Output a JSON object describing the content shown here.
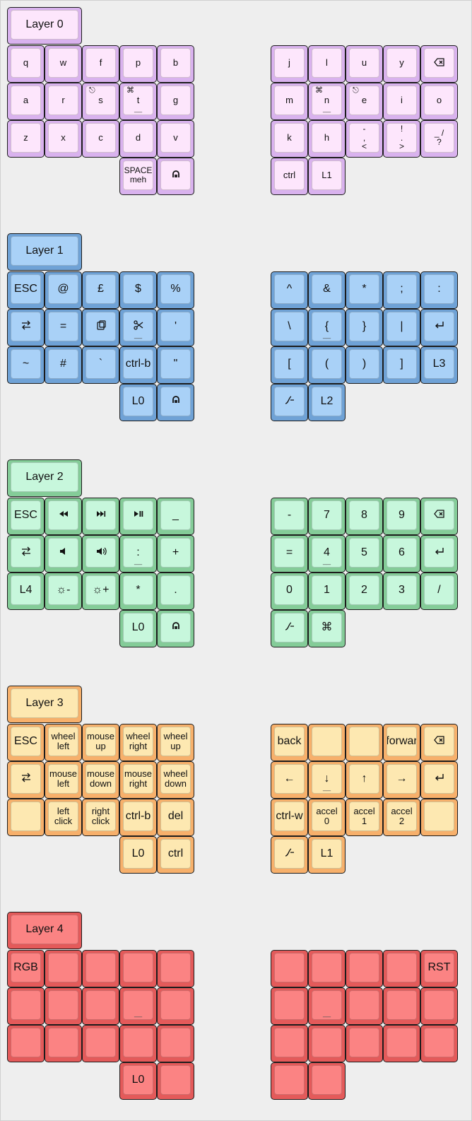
{
  "layers": [
    {
      "title": "Layer 0",
      "colors": {
        "outer": "#d9b2ee",
        "inner": "#fde6fc"
      },
      "size": "small",
      "left": [
        [
          "q",
          "w",
          "f",
          "p",
          "b"
        ],
        [
          "a",
          "r",
          {
            "label": "s",
            "hold": "⎋"
          },
          {
            "label": "t",
            "hold": "⌘",
            "mark": "__"
          },
          "g"
        ],
        [
          "z",
          "x",
          "c",
          "d",
          "v"
        ],
        [
          null,
          null,
          null,
          {
            "label": "SPACE\nmeh",
            "size": "tiny"
          },
          {
            "icon": "sym-icon"
          }
        ]
      ],
      "right": [
        [
          "j",
          "l",
          "u",
          "y",
          {
            "icon": "backspace-icon"
          }
        ],
        [
          "m",
          {
            "label": "n",
            "hold": "⌘",
            "mark": "__"
          },
          {
            "label": "e",
            "hold": "⎋"
          },
          "i",
          "o"
        ],
        [
          "k",
          "h",
          {
            "label": "-\n,\n<",
            "size": "tiny"
          },
          {
            "label": "!\n.\n>",
            "size": "tiny"
          },
          {
            "label": "_  /\n   ?",
            "size": "tiny"
          }
        ],
        [
          "ctrl",
          "L1",
          null,
          null,
          null
        ]
      ]
    },
    {
      "title": "Layer 1",
      "colors": {
        "outer": "#6fa2d6",
        "inner": "#a9d1f7"
      },
      "size": "big",
      "left": [
        [
          "ESC",
          "@",
          "£",
          "$",
          "%"
        ],
        [
          {
            "icon": "tab-icon"
          },
          "=",
          {
            "icon": "paste-icon"
          },
          {
            "icon": "scissors-icon",
            "mark": "__"
          },
          "'"
        ],
        [
          "~",
          "#",
          "`",
          "ctrl-b",
          "\""
        ],
        [
          null,
          null,
          null,
          "L0",
          {
            "icon": "sym-icon"
          }
        ]
      ],
      "right": [
        [
          "^",
          "&",
          "*",
          ";",
          ":"
        ],
        [
          "\\",
          {
            "label": "{",
            "mark": "__"
          },
          "}",
          "|",
          {
            "icon": "enter-icon"
          }
        ],
        [
          "[",
          "(",
          ")",
          "]",
          "L3"
        ],
        [
          {
            "icon": "hyper-icon"
          },
          "L2",
          null,
          null,
          null
        ]
      ]
    },
    {
      "title": "Layer 2",
      "colors": {
        "outer": "#84cc98",
        "inner": "#c7f7dc"
      },
      "size": "big",
      "left": [
        [
          "ESC",
          {
            "icon": "rewind-icon"
          },
          {
            "icon": "next-track-icon"
          },
          {
            "icon": "play-pause-icon"
          },
          "_"
        ],
        [
          {
            "icon": "tab-icon"
          },
          {
            "icon": "volume-down-icon"
          },
          {
            "icon": "volume-up-icon"
          },
          {
            "label": ":",
            "mark": "__"
          },
          "+"
        ],
        [
          "L4",
          "☼-",
          "☼+",
          "*",
          "."
        ],
        [
          null,
          null,
          null,
          "L0",
          {
            "icon": "sym-icon"
          }
        ]
      ],
      "right": [
        [
          "-",
          "7",
          "8",
          "9",
          {
            "icon": "backspace-icon"
          }
        ],
        [
          "=",
          {
            "label": "4",
            "mark": "__"
          },
          "5",
          "6",
          {
            "icon": "enter-icon"
          }
        ],
        [
          "0",
          "1",
          "2",
          "3",
          "/"
        ],
        [
          {
            "icon": "hyper-icon"
          },
          "⌘",
          null,
          null,
          null
        ]
      ]
    },
    {
      "title": "Layer 3",
      "colors": {
        "outer": "#f7b06b",
        "inner": "#fde8b1"
      },
      "size": "big",
      "left": [
        [
          "ESC",
          "wheel\nleft",
          "mouse\nup",
          "wheel\nright",
          "wheel\nup"
        ],
        [
          {
            "icon": "tab-icon"
          },
          "mouse\nleft",
          "mouse\ndown",
          "mouse\nright",
          "wheel\ndown"
        ],
        [
          "",
          "left\nclick",
          "right\nclick",
          "ctrl-b",
          "del"
        ],
        [
          null,
          null,
          null,
          "L0",
          "ctrl"
        ]
      ],
      "right": [
        [
          "back",
          "",
          "",
          "forwar",
          {
            "icon": "backspace-icon"
          }
        ],
        [
          "←",
          {
            "label": "↓",
            "mark": "__"
          },
          "↑",
          "→",
          {
            "icon": "enter-icon"
          }
        ],
        [
          "ctrl-w",
          "accel\n0",
          "accel\n1",
          "accel\n2",
          ""
        ],
        [
          {
            "icon": "hyper-icon"
          },
          "L1",
          null,
          null,
          null
        ]
      ]
    },
    {
      "title": "Layer 4",
      "colors": {
        "outer": "#e45a5a",
        "inner": "#fb8383"
      },
      "size": "big",
      "left": [
        [
          "RGB",
          "",
          "",
          "",
          ""
        ],
        [
          "",
          "",
          "",
          {
            "label": "",
            "mark": "__"
          },
          ""
        ],
        [
          "",
          "",
          "",
          "",
          ""
        ],
        [
          null,
          null,
          null,
          "L0",
          ""
        ]
      ],
      "right": [
        [
          "",
          "",
          "",
          "",
          "RST"
        ],
        [
          "",
          {
            "label": "",
            "mark": "__"
          },
          "",
          "",
          ""
        ],
        [
          "",
          "",
          "",
          "",
          ""
        ],
        [
          "",
          "",
          null,
          null,
          null
        ]
      ]
    }
  ]
}
